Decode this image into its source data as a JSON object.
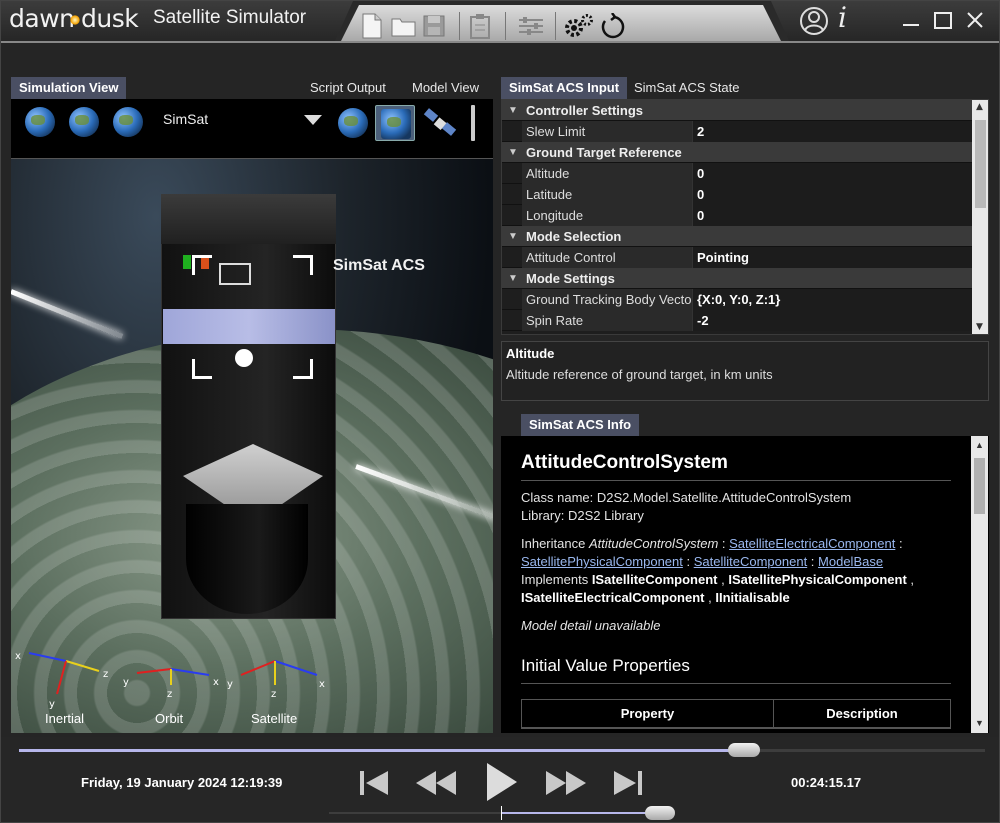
{
  "app": {
    "logo_left": "dawn",
    "logo_right": "dusk",
    "title": "Satellite Simulator"
  },
  "left_tabs": [
    {
      "label": "Simulation View",
      "active": true
    },
    {
      "label": "Script Output",
      "active": false
    },
    {
      "label": "Model View",
      "active": false
    }
  ],
  "sim_toolbar": {
    "selected_object": "SimSat"
  },
  "sim_view": {
    "satellite_label": "SimSat ACS",
    "axes": [
      {
        "label": "Inertial"
      },
      {
        "label": "Orbit"
      },
      {
        "label": "Satellite"
      }
    ]
  },
  "right_tabs": [
    {
      "label": "SimSat ACS Input",
      "active": true
    },
    {
      "label": "SimSat ACS State",
      "active": false
    }
  ],
  "property_grid": {
    "rows": [
      {
        "type": "category",
        "label": "Controller Settings"
      },
      {
        "type": "item",
        "name": "Slew Limit",
        "value": "2"
      },
      {
        "type": "category",
        "label": "Ground Target Reference"
      },
      {
        "type": "item",
        "name": "Altitude",
        "value": "0"
      },
      {
        "type": "item",
        "name": "Latitude",
        "value": "0"
      },
      {
        "type": "item",
        "name": "Longitude",
        "value": "0"
      },
      {
        "type": "category",
        "label": "Mode Selection"
      },
      {
        "type": "item",
        "name": "Attitude Control",
        "value": "Pointing"
      },
      {
        "type": "category",
        "label": "Mode Settings"
      },
      {
        "type": "item",
        "name": "Ground Tracking Body Vector",
        "value": "{X:0, Y:0, Z:1}"
      },
      {
        "type": "item",
        "name": "Spin Rate",
        "value": "-2"
      }
    ]
  },
  "description": {
    "title": "Altitude",
    "text": "Altitude reference of ground target, in km units"
  },
  "info": {
    "tab_label": "SimSat ACS Info",
    "heading": "AttitudeControlSystem",
    "class_name": "Class name: D2S2.Model.Satellite.AttitudeControlSystem",
    "library": "Library: D2S2 Library",
    "inheritance_prefix": "Inheritance ",
    "inheritance_class": "AttitudeControlSystem",
    "inheritance_chain": [
      "SatelliteElectricalComponent",
      "SatellitePhysicalComponent",
      "SatelliteComponent",
      "ModelBase"
    ],
    "implements_prefix": "Implements ",
    "implements": [
      "ISatelliteComponent",
      "ISatellitePhysicalComponent",
      "ISatelliteElectricalComponent",
      "IInitialisable"
    ],
    "model_detail": "Model detail unavailable",
    "section_heading": "Initial Value Properties",
    "table_headers": [
      "Property",
      "Description"
    ]
  },
  "playback": {
    "date": "Friday, 19 January 2024 12:19:39",
    "elapsed": "00:24:15.17",
    "timeline_progress": 0.75,
    "speed_progress": 0.96
  }
}
